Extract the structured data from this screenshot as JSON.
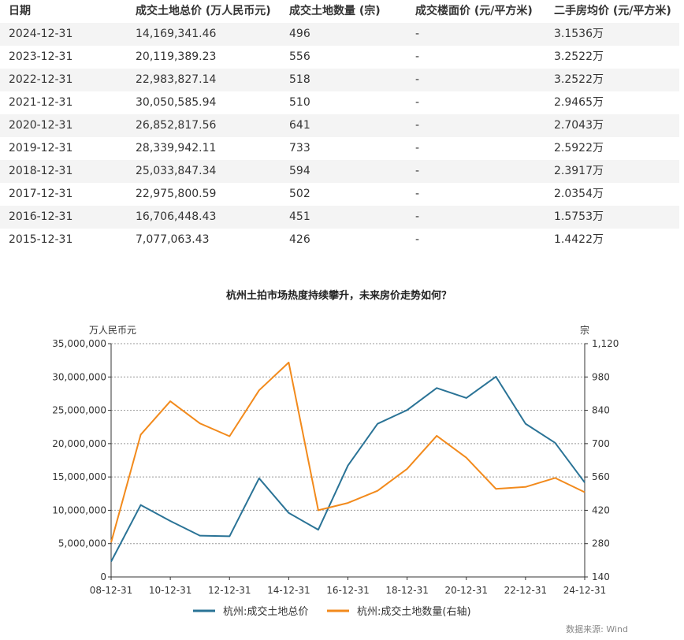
{
  "table": {
    "headers": [
      "日期",
      "成交土地总价 (万人民币元)",
      "成交土地数量 (宗)",
      "成交楼面价 (元/平方米)",
      "二手房均价 (元/平方米)"
    ],
    "rows": [
      [
        "2024-12-31",
        "14,169,341.46",
        "496",
        "-",
        "3.1536万"
      ],
      [
        "2023-12-31",
        "20,119,389.23",
        "556",
        "-",
        "3.2522万"
      ],
      [
        "2022-12-31",
        "22,983,827.14",
        "518",
        "-",
        "3.2522万"
      ],
      [
        "2021-12-31",
        "30,050,585.94",
        "510",
        "-",
        "2.9465万"
      ],
      [
        "2020-12-31",
        "26,852,817.56",
        "641",
        "-",
        "2.7043万"
      ],
      [
        "2019-12-31",
        "28,339,942.11",
        "733",
        "-",
        "2.5922万"
      ],
      [
        "2018-12-31",
        "25,033,847.34",
        "594",
        "-",
        "2.3917万"
      ],
      [
        "2017-12-31",
        "22,975,800.59",
        "502",
        "-",
        "2.0354万"
      ],
      [
        "2016-12-31",
        "16,706,448.43",
        "451",
        "-",
        "1.5753万"
      ],
      [
        "2015-12-31",
        "7,077,063.43",
        "426",
        "-",
        "1.4422万"
      ]
    ]
  },
  "chart_data": {
    "type": "line",
    "title": "杭州土拍市场热度持续攀升，未来房价走势如何？",
    "ylabel": "万人民币元",
    "y2label": "宗",
    "ylim": [
      0,
      35000000
    ],
    "y2lim": [
      140,
      1120
    ],
    "yticks": [
      "0",
      "5,000,000",
      "10,000,000",
      "15,000,000",
      "20,000,000",
      "25,000,000",
      "30,000,000",
      "35,000,000"
    ],
    "y2ticks": [
      "140",
      "280",
      "420",
      "560",
      "700",
      "840",
      "980",
      "1,120"
    ],
    "xticks": [
      "08-12-31",
      "10-12-31",
      "12-12-31",
      "14-12-31",
      "16-12-31",
      "18-12-31",
      "20-12-31",
      "22-12-31",
      "24-12-31"
    ],
    "x": [
      "08-12-31",
      "09-12-31",
      "10-12-31",
      "11-12-31",
      "12-12-31",
      "13-12-31",
      "14-12-31",
      "15-12-31",
      "16-12-31",
      "17-12-31",
      "18-12-31",
      "19-12-31",
      "20-12-31",
      "21-12-31",
      "22-12-31",
      "23-12-31",
      "24-12-31"
    ],
    "series": [
      {
        "name": "杭州:成交土地总价",
        "axis": "left",
        "color": "#2a7396",
        "values": [
          2300000,
          10800000,
          8400000,
          6200000,
          6100000,
          14800000,
          9600000,
          7077063,
          16706448,
          22975801,
          25033847,
          28339942,
          26852818,
          30050586,
          22983827,
          20119389,
          14169341
        ]
      },
      {
        "name": "杭州:成交土地数量(右轴)",
        "axis": "right",
        "color": "#f28a1c",
        "values": [
          285,
          738,
          878,
          785,
          731,
          924,
          1041,
          420,
          451,
          502,
          594,
          733,
          641,
          510,
          518,
          556,
          496
        ]
      }
    ],
    "grid": true,
    "legend": "bottom-center",
    "source": "数据来源: Wind"
  }
}
